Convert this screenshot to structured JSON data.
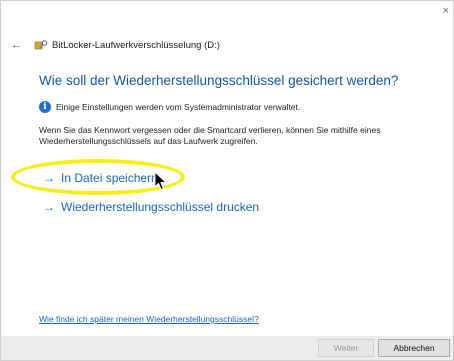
{
  "window": {
    "close_glyph": "×",
    "back_glyph": "←",
    "title": "BitLocker-Laufwerkverschlüsselung (D:)",
    "title_icon": "bitlocker-key-icon"
  },
  "main": {
    "heading": "Wie soll der Wiederherstellungsschlüssel gesichert werden?",
    "info_text": "Einige Einstellungen werden vom Systemadministrator verwaltet.",
    "description": "Wenn Sie das Kennwort vergessen oder die Smartcard verlieren, können Sie mithilfe eines Wiederherstellungsschlüssels auf das Laufwerk zugreifen.",
    "options": [
      {
        "arrow": "→",
        "label": "In Datei speichern"
      },
      {
        "arrow": "→",
        "label": "Wiederherstellungsschlüssel drucken"
      }
    ],
    "help_link": "Wie finde ich später meinen Wiederherstellungsschlüssel?"
  },
  "footer": {
    "next_label": "Weiter",
    "cancel_label": "Abbrechen"
  },
  "colors": {
    "heading": "#1a55a0",
    "link": "#1a65c0",
    "highlight": "#f6ee16",
    "info_icon": "#1f6fc8"
  }
}
